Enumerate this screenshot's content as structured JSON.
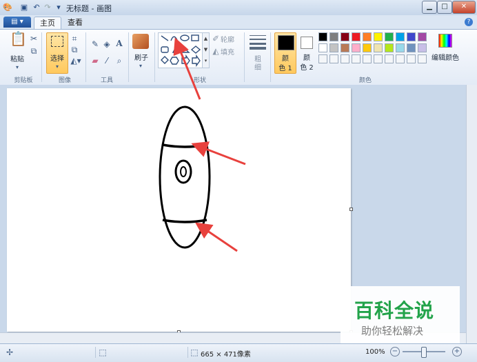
{
  "window": {
    "title": "无标题 - 画图"
  },
  "tabs": {
    "file": "",
    "home": "主页",
    "view": "查看"
  },
  "clipboard": {
    "paste": "粘贴",
    "group": "剪贴板"
  },
  "image": {
    "select": "选择",
    "group": "图像"
  },
  "tools": {
    "group": "工具"
  },
  "brushes": {
    "label": "刷子"
  },
  "shapes": {
    "group": "形状",
    "outline": "轮廓",
    "fill": "填充"
  },
  "size": {
    "label_line1": "粗",
    "label_line2": "细"
  },
  "colors": {
    "color1_line1": "颜",
    "color1_line2": "色 1",
    "color2_line1": "颜",
    "color2_line2": "色 2",
    "edit": "编辑颜色",
    "group": "颜色",
    "color1_value": "#000000",
    "color2_value": "#ffffff",
    "palette_row1": [
      "#000000",
      "#7f7f7f",
      "#880015",
      "#ed1c24",
      "#ff7f27",
      "#fff200",
      "#22b14c",
      "#00a2e8",
      "#3f48cc",
      "#a349a4"
    ],
    "palette_row2": [
      "#ffffff",
      "#c3c3c3",
      "#b97a57",
      "#ffaec9",
      "#ffc90e",
      "#efe4b0",
      "#b5e61d",
      "#99d9ea",
      "#7092be",
      "#c8bfe7"
    ]
  },
  "status": {
    "dimensions": "665 × 471像素",
    "zoom": "100%",
    "zoom_level_fraction": 0.5
  },
  "watermark": {
    "main": "百科全说",
    "sub": "助你轻松解决"
  },
  "accent": {
    "arrow": "#e8413d",
    "select_highlight": "#ffc95e",
    "file_button": "#2b62b0"
  }
}
